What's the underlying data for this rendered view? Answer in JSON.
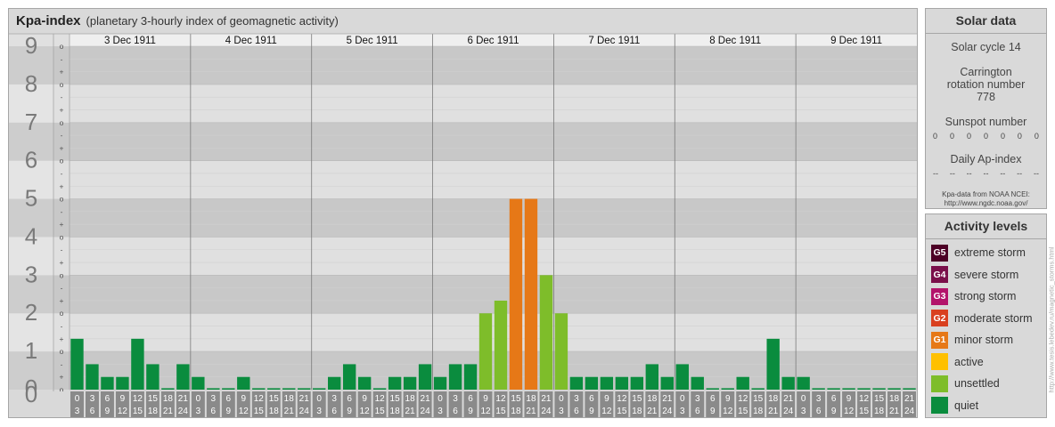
{
  "header": {
    "title": "Kpa-index",
    "subtitle": "(planetary 3-hourly index of geomagnetic activity)"
  },
  "chart_data": {
    "type": "bar",
    "title": "Kpa-index",
    "subtitle": "(planetary 3-hourly index of geomagnetic activity)",
    "ylim": [
      0,
      9
    ],
    "y_ticks": [
      "0",
      "1",
      "2",
      "3",
      "4",
      "5",
      "6",
      "7",
      "8",
      "9"
    ],
    "y_minor_ticks": [
      "+",
      "o",
      "-"
    ],
    "days": [
      "3 Dec 1911",
      "4 Dec 1911",
      "5 Dec 1911",
      "6 Dec 1911",
      "7 Dec 1911",
      "8 Dec 1911",
      "9 Dec 1911"
    ],
    "interval_start": [
      "0",
      "3",
      "6",
      "9",
      "12",
      "15",
      "18",
      "21"
    ],
    "interval_end": [
      "3",
      "6",
      "9",
      "12",
      "15",
      "18",
      "21",
      "24"
    ],
    "values": [
      1.333,
      0.667,
      0.333,
      0.333,
      1.333,
      0.667,
      0,
      0.667,
      0.333,
      0,
      0,
      0.333,
      0,
      0,
      0,
      0,
      0,
      0.333,
      0.667,
      0.333,
      0,
      0.333,
      0.333,
      0.667,
      0.333,
      0.667,
      0.667,
      2,
      2.333,
      5,
      5,
      3,
      2,
      0.333,
      0.333,
      0.333,
      0.333,
      0.333,
      0.667,
      0.333,
      0.667,
      0.333,
      0,
      0,
      0.333,
      0,
      1.333,
      0.333,
      0.333,
      0,
      0,
      0,
      0,
      0,
      0,
      0
    ],
    "legend": "right",
    "grid": true
  },
  "solar": {
    "heading": "Solar data",
    "cycle": "Solar cycle 14",
    "carrington": "Carrington rotation number 778",
    "sunspot_label": "Sunspot number",
    "sunspot_values": [
      "0",
      "0",
      "0",
      "0",
      "0",
      "0",
      "0"
    ],
    "ap_label": "Daily Ap-index",
    "ap_values": [
      "--",
      "--",
      "--",
      "--",
      "--",
      "--",
      "--"
    ],
    "source_line1": "Kpa-data from NOAA NCEI:",
    "source_line2": "http://www.ngdc.noaa.gov/"
  },
  "activity": {
    "heading": "Activity levels",
    "levels": [
      {
        "badge": "G5",
        "label": "extreme storm",
        "color": "#4d0026"
      },
      {
        "badge": "G4",
        "label": "severe storm",
        "color": "#7a0f4a"
      },
      {
        "badge": "G3",
        "label": "strong storm",
        "color": "#b3146b"
      },
      {
        "badge": "G2",
        "label": "moderate storm",
        "color": "#d9401f"
      },
      {
        "badge": "G1",
        "label": "minor storm",
        "color": "#e67817"
      },
      {
        "badge": "",
        "label": "active",
        "color": "#ffc000"
      },
      {
        "badge": "",
        "label": "unsettled",
        "color": "#7ebd2a"
      },
      {
        "badge": "",
        "label": "quiet",
        "color": "#0a8c3e"
      }
    ]
  },
  "watermark": "http://www.tesis.lebedev.ru/magnetic_storms.html"
}
